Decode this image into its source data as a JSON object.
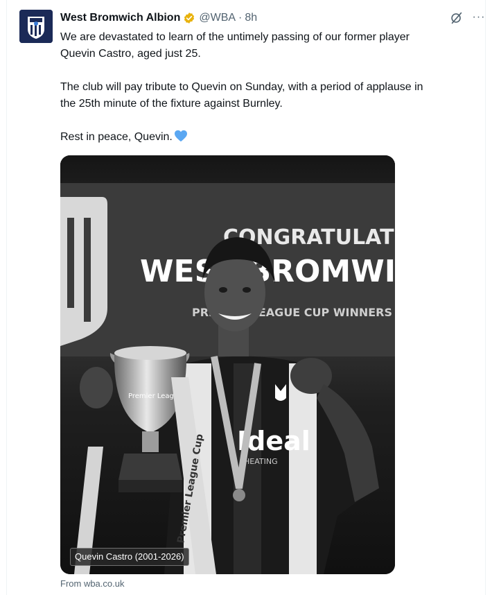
{
  "tweet": {
    "author_name": "West Bromwich Albion",
    "handle": "@WBA",
    "separator": "·",
    "time": "8h",
    "paragraphs": [
      "We are devastated to learn of the untimely passing of our former player\nQuevin Castro, aged just 25.",
      "The club will pay tribute to Quevin on Sunday, with a period of applause in\nthe 25th minute of the fixture against Burnley.",
      "Rest in peace, Quevin."
    ],
    "heart_emoji": "blue-heart-icon",
    "more_label": "···"
  },
  "media": {
    "caption": "Quevin Castro (2001-2026)",
    "banner_line1": "CONGRATULATI",
    "banner_line2": "WEST BROMWICH",
    "banner_line3": "PREMIER LEAGUE CUP WINNERS",
    "shirt_sponsor": "Ideal",
    "shirt_sponsor_sub": "HEATING",
    "trophy_ribbon": "Premier League Cup",
    "trophy_text": "Premier League"
  },
  "source": "From wba.co.uk",
  "colors": {
    "verified": "#e8b20d",
    "heart": "#5aa7f2",
    "muted": "#536471",
    "avatar_bg": "#1b2a57"
  }
}
